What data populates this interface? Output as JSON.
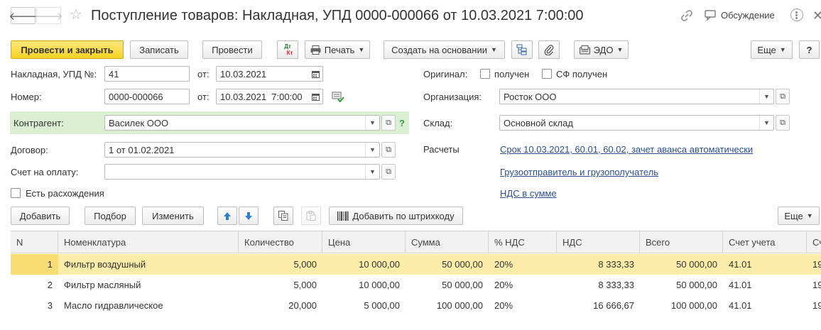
{
  "window": {
    "title": "Поступление товаров: Накладная, УПД 0000-000066 от 10.03.2021 7:00:00",
    "discussion_label": "Обсуждение"
  },
  "toolbar": {
    "post_close": "Провести и закрыть",
    "save": "Записать",
    "post": "Провести",
    "dt_kt_top": "Дт",
    "dt_kt_bottom": "Кт",
    "print": "Печать",
    "create_based": "Создать на основании",
    "edo": "ЭДО",
    "more": "Еще",
    "help": "?"
  },
  "form": {
    "invoice_label": "Накладная, УПД №:",
    "invoice_number": "41",
    "from_label": "от:",
    "invoice_date": "10.03.2021",
    "number_label": "Номер:",
    "number": "0000-000066",
    "doc_datetime": "10.03.2021  7:00:00",
    "counterparty_label": "Контрагент:",
    "counterparty": "Василек ООО",
    "help_mark": "?",
    "contract_label": "Договор:",
    "contract": "1 от 01.02.2021",
    "payment_account_label": "Счет на оплату:",
    "payment_account": "",
    "discrepancies_label": "Есть расхождения",
    "original_label": "Оригинал:",
    "received_label": "получен",
    "sf_received_label": "СФ получен",
    "organization_label": "Организация:",
    "organization": "Росток ООО",
    "warehouse_label": "Склад:",
    "warehouse": "Основной склад",
    "settlements_label": "Расчеты",
    "settlements_link": "Срок 10.03.2021, 60.01, 60.02, зачет аванса автоматически",
    "shipper_link": "Грузоотправитель и грузополучатель",
    "vat_link": "НДС в сумме"
  },
  "table_toolbar": {
    "add": "Добавить",
    "pick": "Подбор",
    "change": "Изменить",
    "add_barcode": "Добавить по штрихкоду",
    "more": "Еще"
  },
  "table": {
    "columns": [
      "N",
      "Номенклатура",
      "Количество",
      "Цена",
      "Сумма",
      "% НДС",
      "НДС",
      "Всего",
      "Счет учета",
      "Сч"
    ],
    "rows": [
      {
        "n": "1",
        "item": "Фильтр воздушный",
        "qty": "5,000",
        "price": "10 000,00",
        "sum": "50 000,00",
        "vat_rate": "20%",
        "vat": "8 333,33",
        "total": "50 000,00",
        "account": "41.01",
        "extra": "19"
      },
      {
        "n": "2",
        "item": "Фильтр масляный",
        "qty": "5,000",
        "price": "10 000,00",
        "sum": "50 000,00",
        "vat_rate": "20%",
        "vat": "8 333,33",
        "total": "50 000,00",
        "account": "41.01",
        "extra": "19"
      },
      {
        "n": "3",
        "item": "Масло гидравлическое",
        "qty": "20,000",
        "price": "5 000,00",
        "sum": "100 000,00",
        "vat_rate": "20%",
        "vat": "16 666,67",
        "total": "100 000,00",
        "account": "41.01",
        "extra": "19"
      }
    ]
  }
}
